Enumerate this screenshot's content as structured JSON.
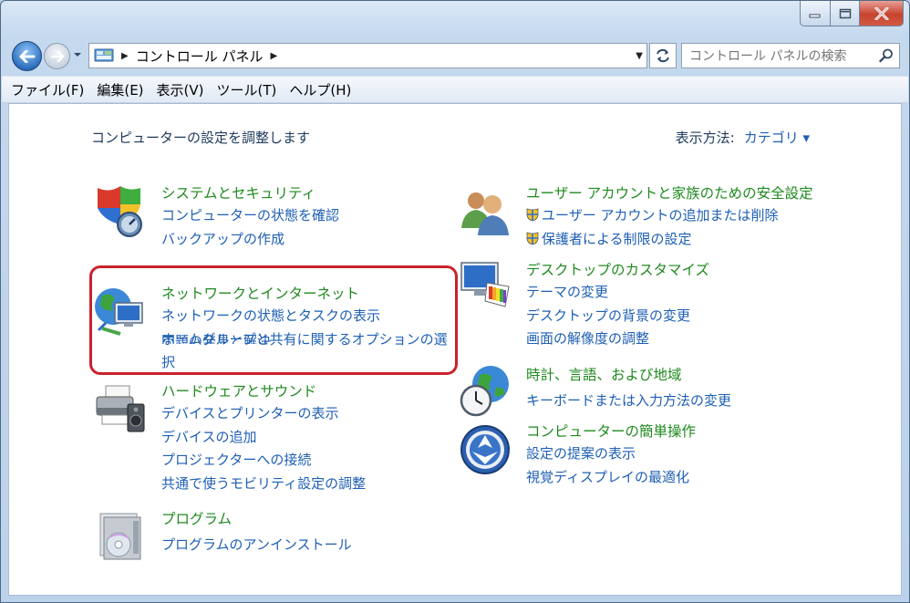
{
  "address": {
    "breadcrumb": "コントロール パネル"
  },
  "search": {
    "placeholder": "コントロール パネルの検索"
  },
  "menu": [
    "ファイル(F)",
    "編集(E)",
    "表示(V)",
    "ツール(T)",
    "ヘルプ(H)"
  ],
  "header": {
    "title": "コンピューターの設定を調整します",
    "view_by_label": "表示方法:",
    "view_by_value": "カテゴリ ▾"
  },
  "categories": {
    "system": {
      "title": "システムとセキュリティ",
      "links": [
        "コンピューターの状態を確認",
        "バックアップの作成",
        "問題の発見と解決"
      ]
    },
    "network": {
      "title": "ネットワークとインターネット",
      "links": [
        "ネットワークの状態とタスクの表示",
        "ホームグループと共有に関するオプションの選",
        "択"
      ]
    },
    "hardware": {
      "title": "ハードウェアとサウンド",
      "links": [
        "デバイスとプリンターの表示",
        "デバイスの追加",
        "プロジェクターへの接続",
        "共通で使うモビリティ設定の調整"
      ]
    },
    "programs": {
      "title": "プログラム",
      "links": [
        "プログラムのアンインストール"
      ]
    },
    "user": {
      "title": "ユーザー アカウントと家族のための安全設定",
      "links": [
        "ユーザー アカウントの追加または削除",
        "保護者による制限の設定"
      ]
    },
    "appearance": {
      "title": "デスクトップのカスタマイズ",
      "links": [
        "テーマの変更",
        "デスクトップの背景の変更",
        "画面の解像度の調整"
      ]
    },
    "clock": {
      "title": "時計、言語、および地域",
      "links": [
        "キーボードまたは入力方法の変更"
      ]
    },
    "ease": {
      "title": "コンピューターの簡単操作",
      "links": [
        "設定の提案の表示",
        "視覚ディスプレイの最適化"
      ]
    }
  }
}
